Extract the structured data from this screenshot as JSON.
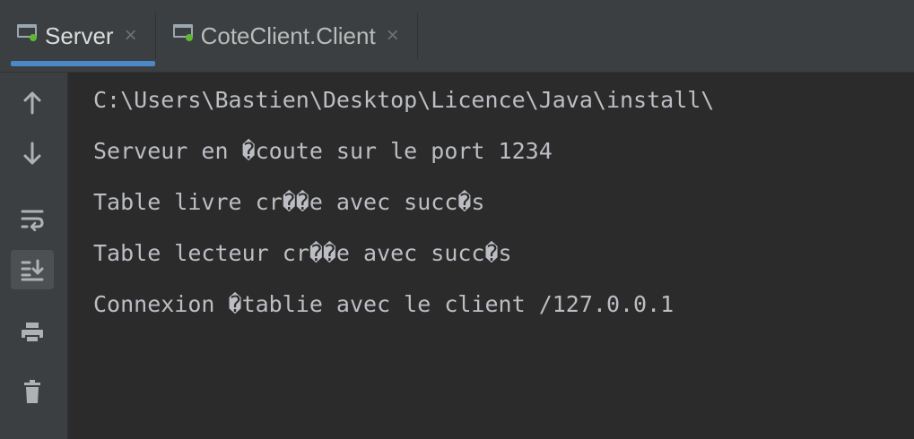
{
  "tabs": [
    {
      "label": "Server",
      "close": "×",
      "icon": "console-window-icon",
      "active": true
    },
    {
      "label": "CoteClient.Client",
      "close": "×",
      "icon": "console-window-icon",
      "active": false
    }
  ],
  "toolbar": {
    "items": [
      {
        "name": "scroll-up-icon",
        "glyph": "↑"
      },
      {
        "name": "scroll-down-icon",
        "glyph": "↓"
      },
      {
        "name": "soft-wrap-icon"
      },
      {
        "name": "scroll-to-end-icon",
        "pressed": true
      },
      {
        "name": "print-icon"
      },
      {
        "name": "clear-all-icon"
      }
    ]
  },
  "console": {
    "lines": [
      "C:\\Users\\Bastien\\Desktop\\Licence\\Java\\install\\",
      "Serveur en �coute sur le port 1234",
      "Table livre cr��e avec succ�s",
      "Table lecteur cr��e avec succ�s",
      "Connexion �tablie avec le client /127.0.0.1"
    ]
  },
  "colors": {
    "background": "#2b2b2b",
    "panel": "#3c3f41",
    "text": "#bcbec4",
    "accent": "#4a88c7",
    "status_dot": "#5fb832"
  }
}
